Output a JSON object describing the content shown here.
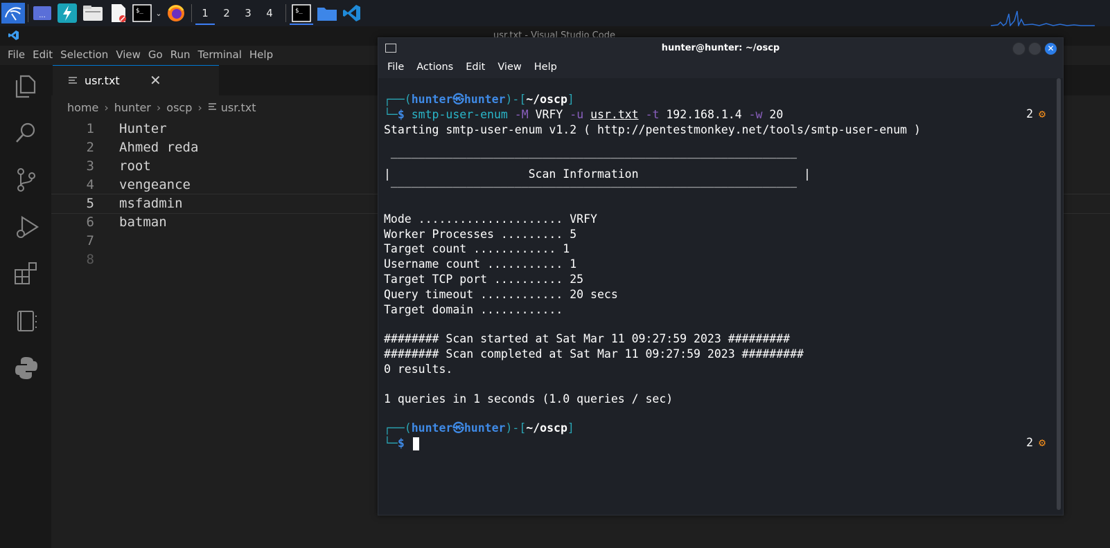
{
  "taskbar": {
    "workspaces": [
      "1",
      "2",
      "3",
      "4"
    ],
    "active_workspace": "1",
    "apps": [
      "kali-menu",
      "desktop-switcher",
      "bolt-launcher",
      "file-manager",
      "text-editor",
      "terminal",
      "firefox"
    ],
    "open_windows": [
      "terminal",
      "files",
      "vscode"
    ]
  },
  "vscode": {
    "window_title": "usr.txt - Visual Studio Code",
    "menu": [
      "File",
      "Edit",
      "Selection",
      "View",
      "Go",
      "Run",
      "Terminal",
      "Help"
    ],
    "tab": {
      "label": "usr.txt",
      "close": "✕"
    },
    "breadcrumb": [
      "home",
      "hunter",
      "oscp",
      "usr.txt"
    ],
    "lines": [
      {
        "num": "1",
        "text": "Hunter"
      },
      {
        "num": "2",
        "text": "Ahmed reda"
      },
      {
        "num": "3",
        "text": "root"
      },
      {
        "num": "4",
        "text": "vengeance"
      },
      {
        "num": "5",
        "text": "msfadmin"
      },
      {
        "num": "6",
        "text": "batman"
      },
      {
        "num": "7",
        "text": ""
      },
      {
        "num": "8",
        "text": ""
      }
    ],
    "current_line": 5
  },
  "terminal": {
    "title": "hunter@hunter: ~/oscp",
    "menu": [
      "File",
      "Actions",
      "Edit",
      "View",
      "Help"
    ],
    "prompt": {
      "user": "hunter",
      "host": "hunter",
      "skull": "㉿",
      "dir": "~/oscp",
      "symbol": "$"
    },
    "command": {
      "name": "smtp-user-enum",
      "opt1": "-M",
      "val1": "VRFY",
      "opt2": "-u",
      "val2": "usr.txt",
      "opt3": "-t",
      "val3": "192.168.1.4",
      "opt4": "-w",
      "val4": "20"
    },
    "badge_count": "2",
    "output": {
      "starting": "Starting smtp-user-enum v1.2 ( http://pentestmonkey.net/tools/smtp-user-enum )",
      "box_rule": " ___________________________________________________________",
      "box_title": "|                    Scan Information                        |",
      "box_rule_bottom": " ___________________________________________________________",
      "mode": "Mode ..................... VRFY",
      "workers": "Worker Processes ......... 5",
      "target_count": "Target count ............ 1",
      "username_count": "Username count ........... 1",
      "tcp_port": "Target TCP port .......... 25",
      "query_timeout": "Query timeout ............ 20 secs",
      "target_domain": "Target domain ............",
      "scan_started": "######## Scan started at Sat Mar 11 09:27:59 2023 #########",
      "scan_completed": "######## Scan completed at Sat Mar 11 09:27:59 2023 #########",
      "results": "0 results.",
      "queries": "1 queries in 1 seconds (1.0 queries / sec)"
    }
  },
  "colors": {
    "accent": "#0078d4",
    "prompt_blue": "#3f8ae6",
    "prompt_teal": "#2aa6b5",
    "option_purple": "#8a5fbf",
    "badge_orange": "#f08c1c"
  }
}
